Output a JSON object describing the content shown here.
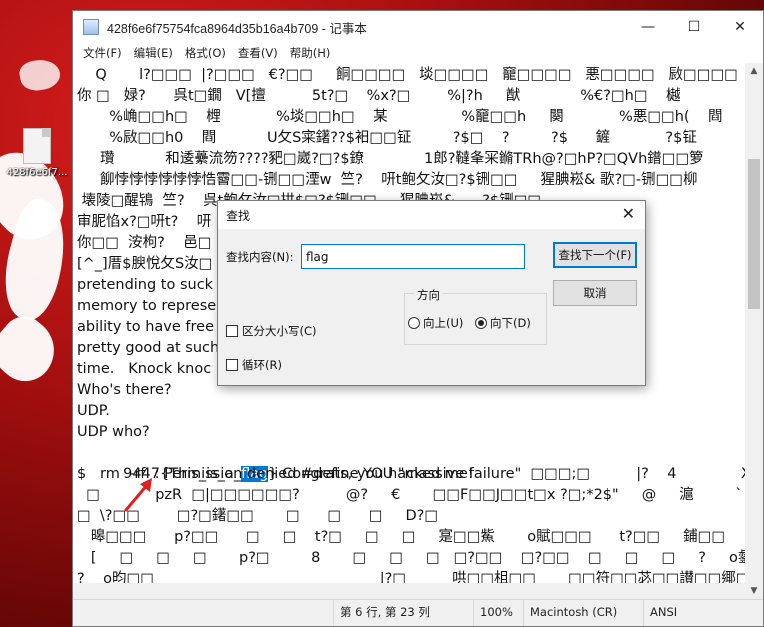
{
  "desktop": {
    "icon_label": "428f6e6f7..."
  },
  "window": {
    "title": "428f6e6f75754fca8964d35b16a4b709 - 记事本",
    "controls": {
      "minimize": "—",
      "maximize": "☐",
      "close": "✕"
    }
  },
  "menu": [
    "文件(F)",
    "编辑(E)",
    "格式(O)",
    "查看(V)",
    "帮助(H)"
  ],
  "content": {
    "lines": [
      "    Q       l?□□□  |?□□□   €?□□     餇□□□□   埮□□□□   竉□□□□   悪□□□□   敐□□□□   U攵S洝□?    [",
      "你 □   娽?      呉t□鐗   V[擅          5t?□    %x?□        %|?h     猷             %€?□h□    樾",
      "       %崅□□h□    榸            %埮□□h□    某                %竉□□h     闋            %悪□□h(    閰",
      "       %敐□□h0    閰           U攵S寀鐯??$衵□□钲         ?$□    ?         ?$      鏟            ?$钲",
      "     瓚           和逶虆流笏????豝□崴?□?$鐐             1郎?韃夆冞鏅TRh@?□hP?□QVh鐠□□箩",
      "     飹悖悖悖悖悖悖悎霫□□-铏□□湮w  竺?    咞t鲍攵汝□?$铏□□     猩腆崧& 歌?□-铏□□柳",
      " 壊陵□醒鴇  竺?    呉t鲍攵汝□拱$□?$铏□□     猩腆崧&      ?$铏□□",
      "审胒惂x?□咞t?    咞                                                                     攵WVS鐿",
      "你□□  洝枸?    邑□                                                                     癄□9绌迟?",
      "[^_]厝$腴悅攵S汝□                                                                        You're",
      "pretending to suck                                                                      bits in my",
      "memory to represe                                                                       ood as my",
      "ability to have free                                                                     ? You're",
      "pretty good at such                                                                     Maybe next",
      "time.   Knock knoc",
      "Who's there?",
      "UDP.",
      "UDP who?",
      "    9447{This_is_a_flag} Congrats, you hacked me!",
      "$   rm  -rf  : Permission denied #define YOU \"massive failure\"  □□□;□          |?    4              X",
      "  □            pzR  □|□□□□□□?          @?     €       □□F□□J□□t□x ?□;*2$\"     @     滬         `      A□□?B",
      "□  \\?□□        □?□鐯□□       □      □      □     D?□",
      "   暤□□□      p?□□      □     □    t?□     □     □     寔□□鮆       o賦□□□      t?□□     鋪□□",
      "   [     □     □     □       p?□         8       □     □     □   □?□□    □?□□    □     □     □     ?     o錖□□             o□",
      "?    o昀□□                                                 |?□          哄□□柤□□       □□符□□苾□□讃□□鄊□□"
    ],
    "highlight": {
      "line_index": 18,
      "before": "    9447{This_is_a_",
      "match": "flag",
      "after": "} Congrats, you hacked me!"
    }
  },
  "statusbar": {
    "position": "第 6 行, 第 23 列",
    "zoom": "100%",
    "line_ending": "Macintosh (CR)",
    "encoding": "ANSI"
  },
  "find_dialog": {
    "title": "查找",
    "find_label": "查找内容(N):",
    "find_value": "flag",
    "find_next_button": "查找下一个(F)",
    "cancel_button": "取消",
    "direction_label": "方向",
    "up_label": "向上(U)",
    "down_label": "向下(D)",
    "selected_direction": "down",
    "match_case_label": "区分大小写(C)",
    "wrap_label": "循环(R)",
    "match_case_checked": false,
    "wrap_checked": false
  },
  "colors": {
    "selection": "#0078d7",
    "annotation_arrow": "#e02020",
    "desktop_red": "#a50f0f"
  }
}
